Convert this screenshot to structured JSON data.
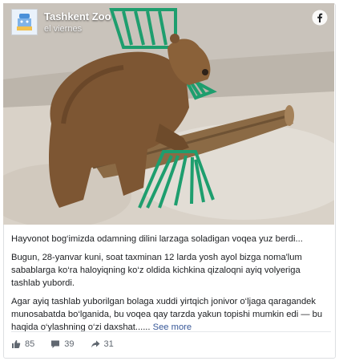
{
  "post": {
    "page_name": "Tashkent Zoo",
    "timestamp": "el viernes",
    "paragraphs": [
      "Hayvonot bog‘imizda odamning dilini larzaga soladigan voqea yuz berdi...",
      "Bugun, 28-yanvar kuni, soat taxminan 12 larda yosh ayol bizga noma'lum sabablarga ko‘ra haloyiqning ko‘z oldida kichkina qizaloqni ayiq volyeriga tashlab yubordi.",
      "Agar ayiq tashlab yuborilgan bolaga xuddi yirtqich jonivor o‘ljaga qaragandek munosabatda bo‘lganida, bu voqea qay tarzda yakun topishi mumkin edi — bu haqida o‘ylashning o‘zi daxshat......"
    ],
    "see_more": "See more"
  },
  "stats": {
    "likes": "85",
    "comments": "39",
    "shares": "31"
  },
  "icons": {
    "brand": "facebook-icon",
    "like": "thumbs-up-icon",
    "comment": "comment-icon",
    "share": "share-arrow-icon"
  },
  "colors": {
    "link": "#385898",
    "facebook_brand": "#ffffff",
    "muted_text": "#606770"
  }
}
